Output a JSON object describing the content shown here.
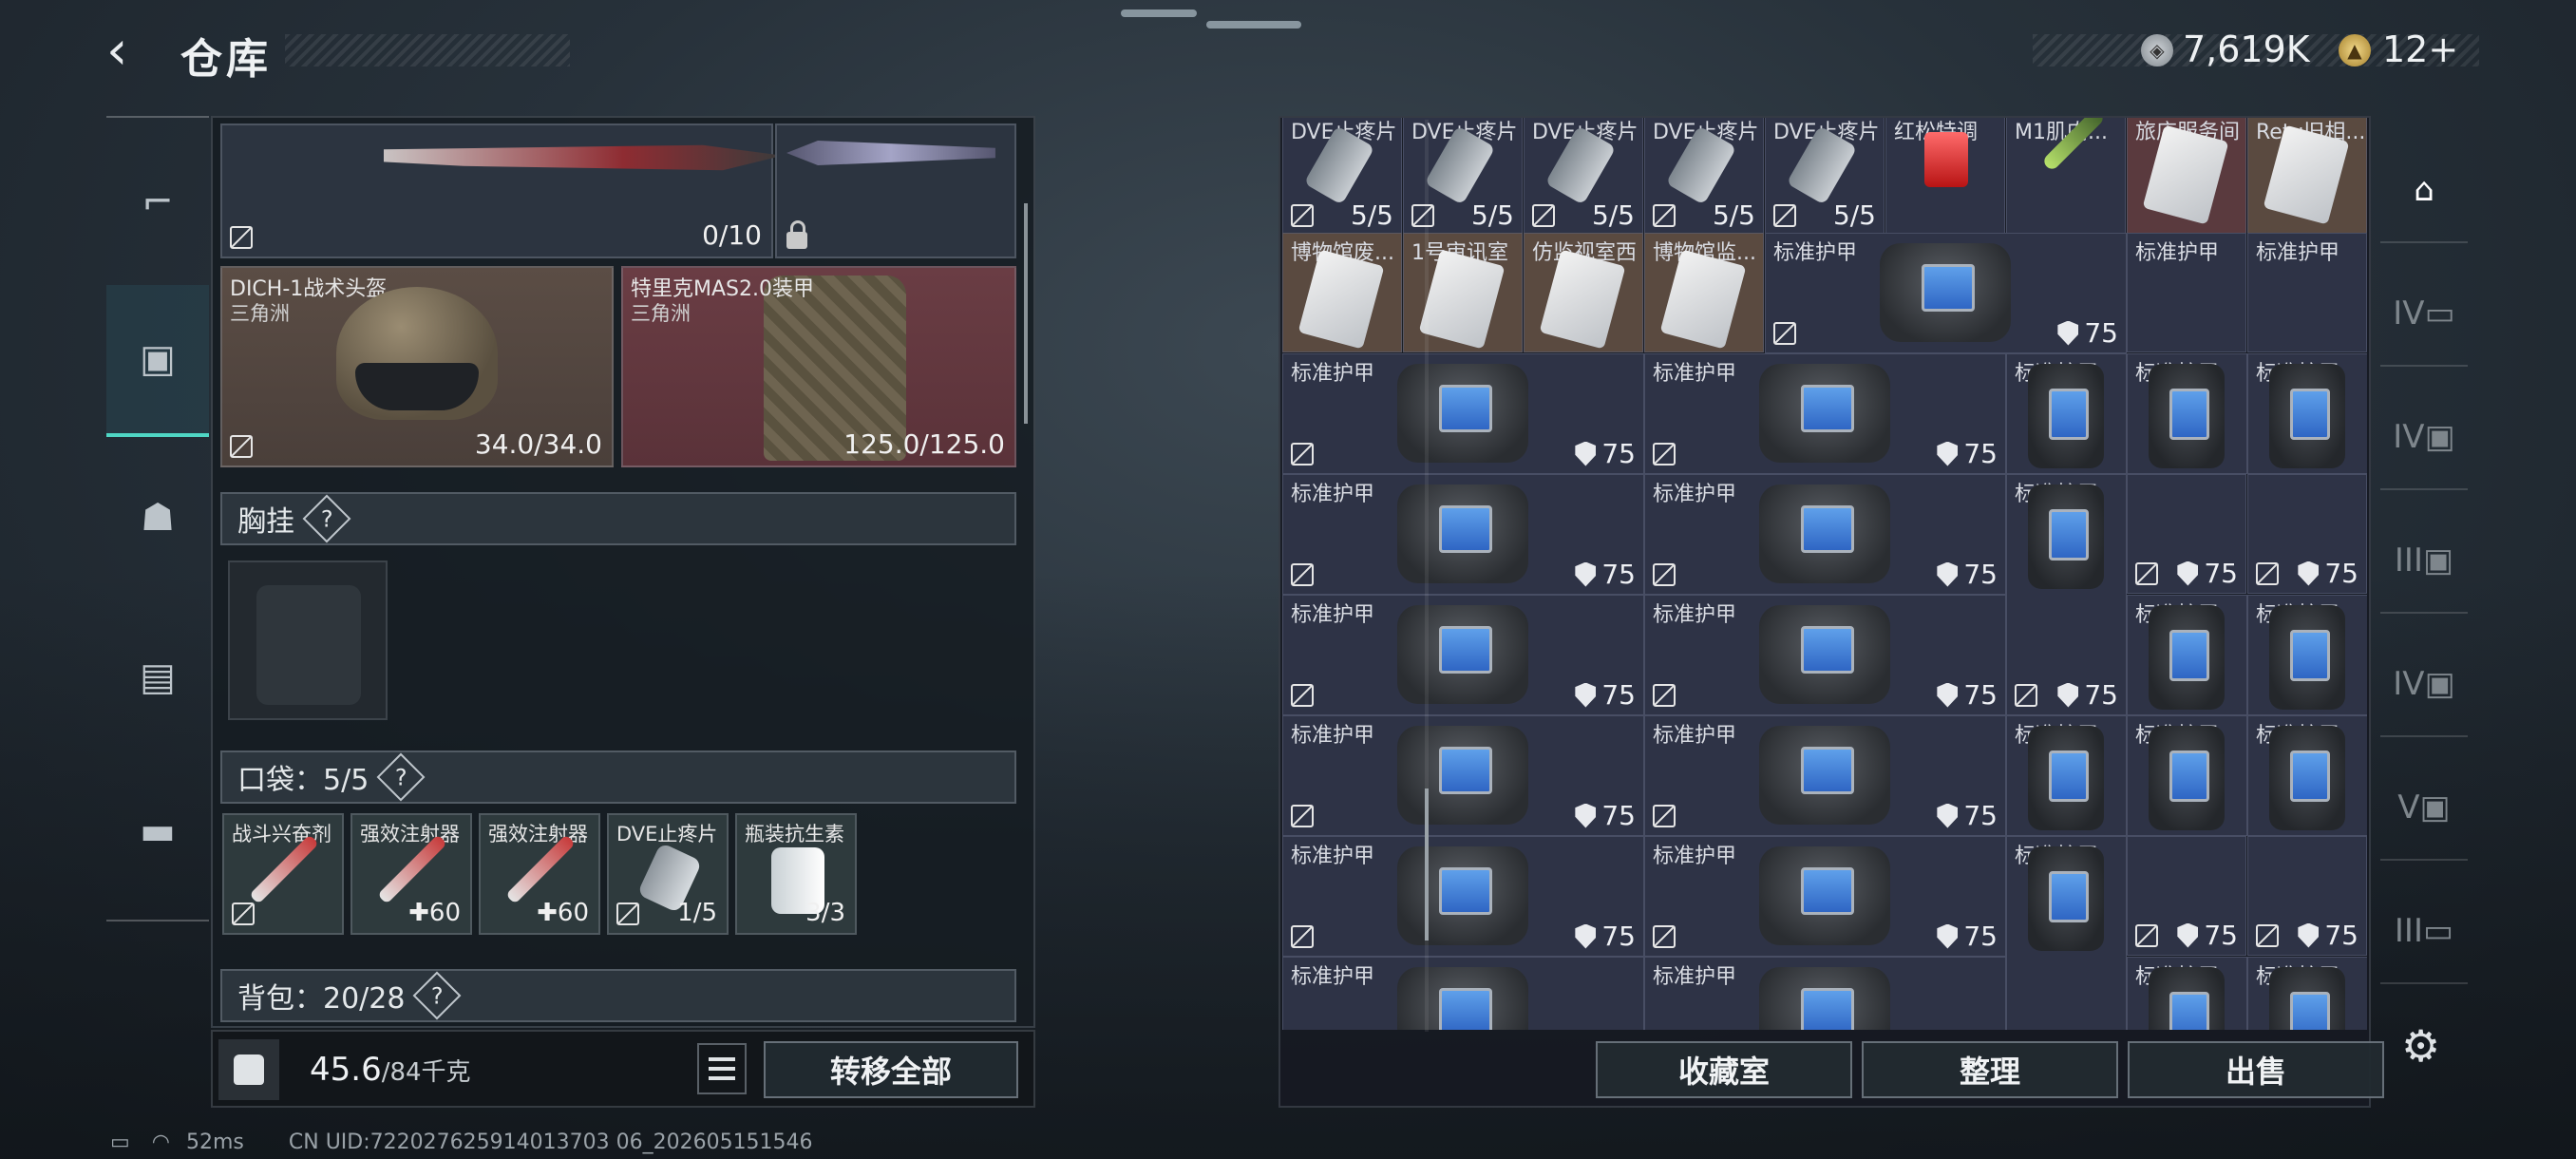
{
  "header": {
    "back_icon": "‹",
    "title": "仓库",
    "currency1": "7,619K",
    "currency2": "12+"
  },
  "left_nav": [
    "weapon-icon",
    "backpack-gear-icon",
    "backpack-icon",
    "chest-rig-icon",
    "case-icon"
  ],
  "equipment": {
    "weapon_value": "0/10",
    "helmet": {
      "name": "DICH-1战术头盔",
      "sub": "三角洲",
      "value": "34.0/34.0"
    },
    "armor": {
      "name": "特里克MAS2.0装甲",
      "sub": "三角洲",
      "value": "125.0/125.0"
    }
  },
  "chest_rig": {
    "label": "胸挂"
  },
  "pockets": {
    "label": "口袋：5/5",
    "items": [
      {
        "name": "战斗兴奋剂",
        "value": ""
      },
      {
        "name": "强效注射器",
        "value": "60"
      },
      {
        "name": "强效注射器",
        "value": "60"
      },
      {
        "name": "DVE止疼片",
        "value": "1/5"
      },
      {
        "name": "瓶装抗生素",
        "value": "3/3"
      }
    ]
  },
  "backpack": {
    "label": "背包：20/28"
  },
  "footer": {
    "weight": "45.6",
    "weight_max": "/84千克",
    "transfer_all": "转移全部"
  },
  "status": {
    "ping": "52ms",
    "uid": "CN UID:722027625914013703 06_202605151546"
  },
  "grid": {
    "top_row": [
      {
        "name": "DVE止疼片",
        "value": "5/5"
      },
      {
        "name": "DVE止疼片",
        "value": "5/5"
      },
      {
        "name": "DVE止疼片",
        "value": "5/5"
      },
      {
        "name": "DVE止疼片",
        "value": "5/5"
      },
      {
        "name": "DVE止疼片",
        "value": "5/5"
      },
      {
        "name": "红松特调",
        "value": ""
      },
      {
        "name": "M1肌肉...",
        "value": ""
      },
      {
        "name": "旅店服务间",
        "value": ""
      },
      {
        "name": "Retu旧相...",
        "value": ""
      }
    ],
    "row2_cards": [
      "博物馆废...",
      "1号审讯室",
      "仿监视室西",
      "博物馆监..."
    ],
    "armor_name": "标准护甲",
    "armor_value": "75"
  },
  "actions": {
    "collection": "收藏室",
    "sort": "整理",
    "sell": "出售"
  }
}
